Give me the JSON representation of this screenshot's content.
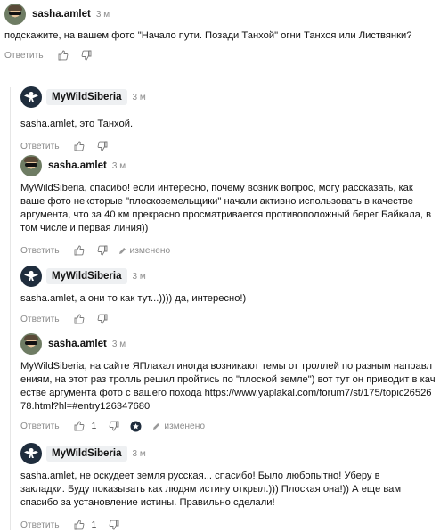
{
  "comments": [
    {
      "author": "sasha.amlet",
      "time": "3 м",
      "text": "подскажите, на вашем фото \"Начало пути. Позади Танхой\" огни Танхоя или Листвянки?",
      "reply_label": "Ответить"
    },
    {
      "author": "MyWildSiberia",
      "time": "3 м",
      "text": "sasha.amlet, это Танхой.",
      "reply_label": "Ответить"
    },
    {
      "author": "sasha.amlet",
      "time": "3 м",
      "text": "MyWildSiberia, спасибо! если интересно, почему возник вопрос, могу рассказать, как ваше фото некоторые \"плоскоземельщики\" начали активно использовать в качестве аргумента, что за 40 км прекрасно просматривается противоположный берег Байкала, в том числе и первая линия))",
      "reply_label": "Ответить",
      "edited": "изменено"
    },
    {
      "author": "MyWildSiberia",
      "time": "3 м",
      "text": "sasha.amlet, а они то как тут...)))) да, интересно!)",
      "reply_label": "Ответить"
    },
    {
      "author": "sasha.amlet",
      "time": "3 м",
      "text": "MyWildSiberia, на сайте ЯПлакал иногда возникают темы от троллей по разным направлениям, на этот раз тролль решил пройтись по \"плоской земле\") вот тут он приводит в качестве аргумента фото с вашего похода https://www.yaplakal.com/forum7/st/175/topic2652678.html?hl=#entry126347680",
      "reply_label": "Ответить",
      "likes": "1",
      "edited": "изменено"
    },
    {
      "author": "MyWildSiberia",
      "time": "3 м",
      "text": "sasha.amlet, не оскудеет земля русская... спасибо! Было любопытно! Уберу в закладки. Буду показывать как людям истину открыл.))) Плоская она!)) А еще вам спасибо за установление истины. Правильно сделали!",
      "reply_label": "Ответить",
      "likes": "1"
    }
  ],
  "icons": {
    "like": "thumbs-up-icon",
    "dislike": "thumbs-down-icon",
    "edited": "pencil-icon",
    "award": "award-icon"
  }
}
